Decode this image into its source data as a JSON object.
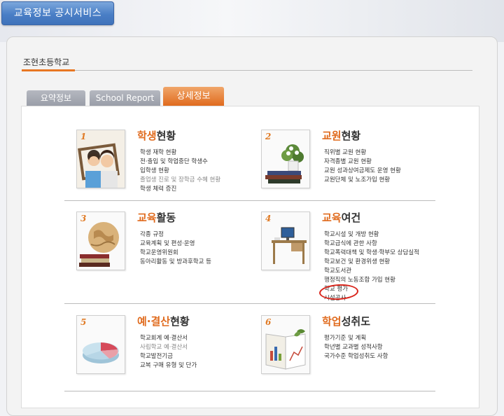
{
  "header": {
    "title": "교육정보 공시서비스"
  },
  "school": {
    "name": "조현초등학교"
  },
  "tabs": [
    {
      "label": "요약정보",
      "active": false
    },
    {
      "label": "School Report",
      "active": false
    },
    {
      "label": "상세정보",
      "active": true
    }
  ],
  "sections": [
    {
      "num": "1",
      "title_hl": "학생",
      "title_rest": "현황",
      "icon": "children-photo-icon",
      "items": [
        "학생 재학 현황",
        "전·출입 및 학업중단 학생수",
        "입학생 현황",
        "졸업생 진로 및 장학금 수혜 현황",
        "학생 체력 증진"
      ]
    },
    {
      "num": "2",
      "title_hl": "교원",
      "title_rest": "현황",
      "icon": "books-plant-icon",
      "items": [
        "직위별 교원 현황",
        "자격종별 교원 현황",
        "교원 성과상여금제도 운영 현황",
        "교원단체 및 노조가입 현황"
      ]
    },
    {
      "num": "3",
      "title_hl": "교육",
      "title_rest": "활동",
      "icon": "globe-icon",
      "items": [
        "각종 규정",
        "교육계획 및 편성·운영",
        "학교운영위원회",
        "동아리활동 및 방과후학교 등"
      ]
    },
    {
      "num": "4",
      "title_hl": "교육",
      "title_rest": "여건",
      "icon": "desk-computer-icon",
      "items": [
        "학교시설 및 개방 현황",
        "학교급식에 관한 사항",
        "학교폭력대책 및 학생·학부모 상담실적",
        "학교보건 및 환경위생 현황",
        "학교도서관",
        "행정직의 노동조합 가입 현황",
        "학교 평가",
        "시설공사"
      ]
    },
    {
      "num": "5",
      "title_hl": "예·결산",
      "title_rest": "현황",
      "icon": "pie-chart-icon",
      "items": [
        "학교회계 예·결산서",
        "사립학교 예·결산서",
        "학교발전기금",
        "교복 구매 유형 및 단가"
      ]
    },
    {
      "num": "6",
      "title_hl": "학업",
      "title_rest": "성취도",
      "icon": "book-chart-icon",
      "items": [
        "평가기준 및 계획",
        "학년별 교과별 성적사항",
        "국가수준 학업성취도 사항"
      ]
    }
  ]
}
